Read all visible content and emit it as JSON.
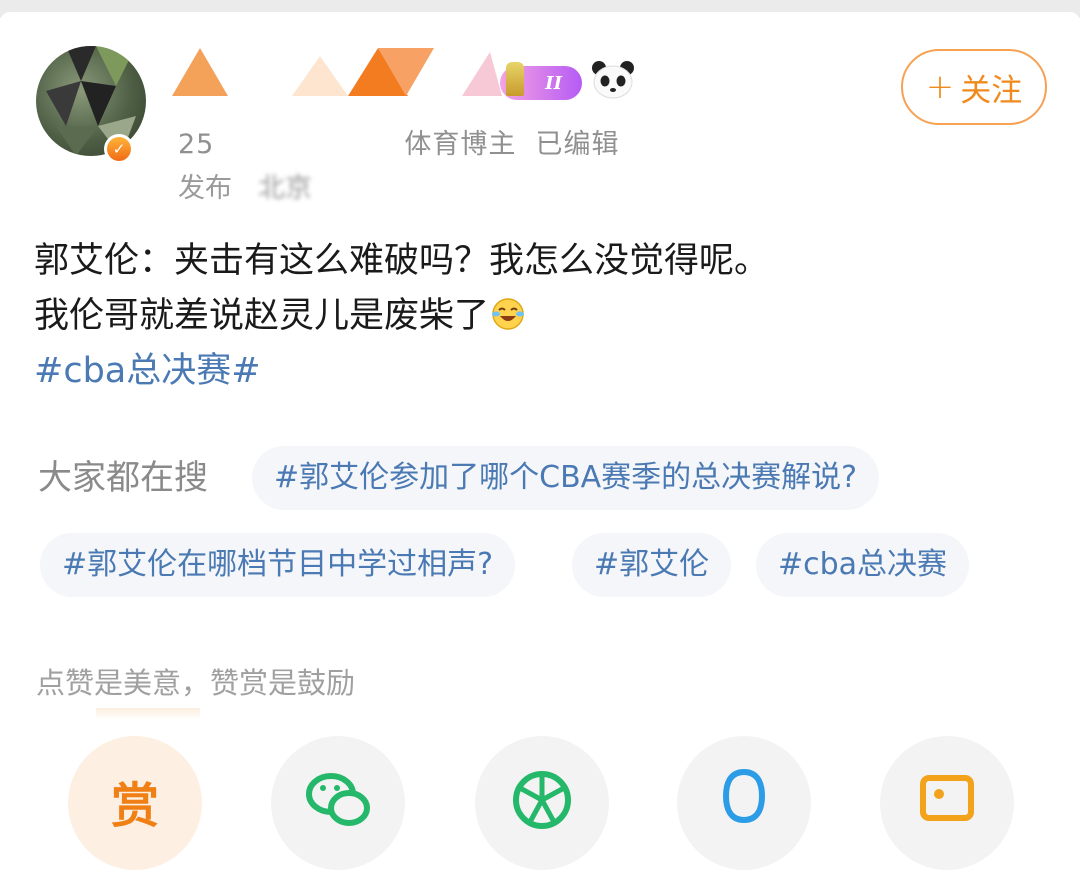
{
  "header": {
    "meta": {
      "prefix": "25",
      "role": "体育博主",
      "edited": "已编辑",
      "posted_prefix": "发布",
      "posted_suffix": "北京"
    },
    "level": "II",
    "follow_button": {
      "plus": "+",
      "label": "关注"
    }
  },
  "post": {
    "lines": [
      "郭艾伦：夹击有这么难破吗？我怎么没觉得呢。",
      "我伦哥就差说赵灵儿是废柴了"
    ],
    "hashtag": "#cba总决赛#"
  },
  "search": {
    "label": "大家都在搜",
    "chips": [
      "#郭艾伦参加了哪个CBA赛季的总决赛解说?",
      "#郭艾伦在哪档节目中学过相声?",
      "#郭艾伦",
      "#cba总决赛"
    ]
  },
  "reward": {
    "hint": "点赞是美意，赞赏是鼓励",
    "reward_char": "赏"
  },
  "colors": {
    "accent_orange": "#f08a1d",
    "link_blue": "#4a79b3",
    "chip_bg": "#f4f6f9"
  },
  "icons": [
    "verified-badge-icon",
    "trophy-icon",
    "panda-icon",
    "laughing-crying-emoji-icon",
    "wechat-icon",
    "moments-icon",
    "qq-icon",
    "qzone-icon"
  ]
}
